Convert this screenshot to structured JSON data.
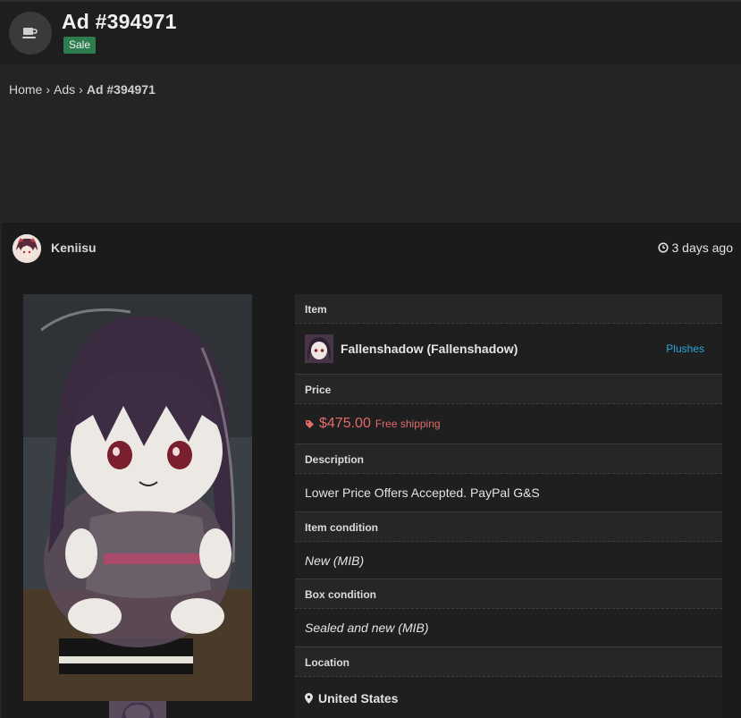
{
  "header": {
    "title": "Ad #394971",
    "badge": "Sale",
    "logo_icon": "coffee-cup-icon"
  },
  "breadcrumb": {
    "home": "Home",
    "ads": "Ads",
    "current": "Ad #394971",
    "separator": "›"
  },
  "post": {
    "username": "Keniisu",
    "posted_ago": "3 days ago",
    "clock_icon": "clock-icon"
  },
  "details": {
    "item_label": "Item",
    "item_name": "Fallenshadow (Fallenshadow)",
    "item_category": "Plushes",
    "price_label": "Price",
    "price": "$475.00",
    "shipping": "Free shipping",
    "description_label": "Description",
    "description": "Lower Price Offers Accepted. PayPal G&S",
    "item_condition_label": "Item condition",
    "item_condition": "New (MIB)",
    "box_condition_label": "Box condition",
    "box_condition": "Sealed and new (MIB)",
    "location_label": "Location",
    "location": "United States"
  },
  "colors": {
    "badge": "#2e7d4f",
    "price": "#e06b6b",
    "link": "#2ba3e0"
  }
}
